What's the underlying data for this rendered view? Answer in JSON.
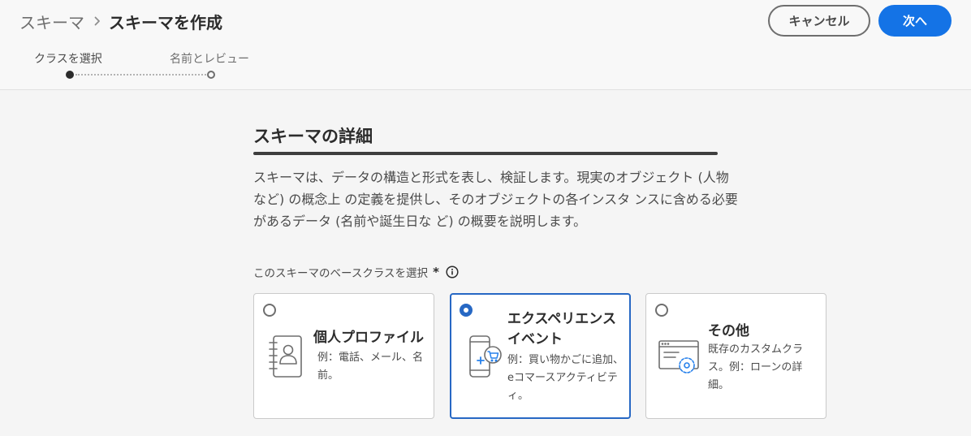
{
  "breadcrumb": {
    "root": "スキーマ",
    "current": "スキーマを作成"
  },
  "actions": {
    "cancel_label": "キャンセル",
    "next_label": "次へ"
  },
  "steps": [
    {
      "label": "クラスを選択",
      "state": "current"
    },
    {
      "label": "名前とレビュー",
      "state": "pending"
    }
  ],
  "section": {
    "title": "スキーマの詳細",
    "description": "スキーマは、データの構造と形式を表し、検証します。現実のオブジェクト (人物など) の概念上 の定義を提供し、そのオブジェクトの各インスタ ンスに含める必要があるデータ (名前や誕生日な ど) の概要を説明します。"
  },
  "base_class": {
    "label": "このスキーマのベースクラスを選択",
    "required_marker": "*",
    "info_icon": "info-icon",
    "options": [
      {
        "title": "個人プロファイル",
        "description": "例：電話、メール、名前。",
        "icon": "address-book-icon",
        "selected": false
      },
      {
        "title": "エクスペリエンスイベント",
        "description": "例：買い物かごに追加、eコマースアクティビティ。",
        "icon": "mobile-cart-icon",
        "selected": true
      },
      {
        "title": "その他",
        "description": "既存のカスタムクラス。例：ローンの詳細。",
        "icon": "browser-settings-icon",
        "selected": false
      }
    ]
  },
  "colors": {
    "accent": "#1473e6",
    "selected_border": "#2768c4",
    "icon_blue": "#2680eb"
  }
}
